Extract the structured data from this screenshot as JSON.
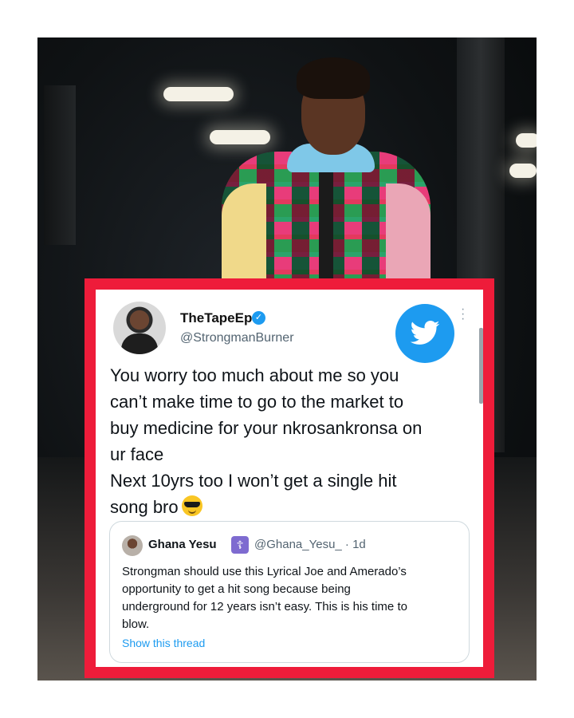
{
  "tweet": {
    "author_name": "TheTapeEp",
    "author_handle": "@StrongmanBurner",
    "text_lines": [
      "You worry too much about me so you",
      "can’t make time to go to the market to",
      "buy medicine for your nkrosankronsa on",
      "ur face",
      "Next 10yrs too I won’t get a single hit",
      "song bro"
    ],
    "emoji": "smiling-face-with-sunglasses"
  },
  "quoted_tweet": {
    "author_name": "Ghana Yesu",
    "badge_glyph": "☦",
    "author_handle": "@Ghana_Yesu_ · 1d",
    "text_lines": [
      "Strongman should use this Lyrical Joe and Amerado’s",
      "opportunity to get a hit song because being",
      "underground for 12 years isn’t easy. This is his time to",
      "blow."
    ],
    "show_thread": "Show this thread"
  },
  "colors": {
    "frame_red": "#ee1c3a",
    "twitter_blue": "#1d9bf0",
    "handle_grey": "#536471"
  },
  "icons": {
    "verified": "verified-badge-icon",
    "brand": "twitter-bird-icon",
    "menu": "more-vertical-icon"
  }
}
